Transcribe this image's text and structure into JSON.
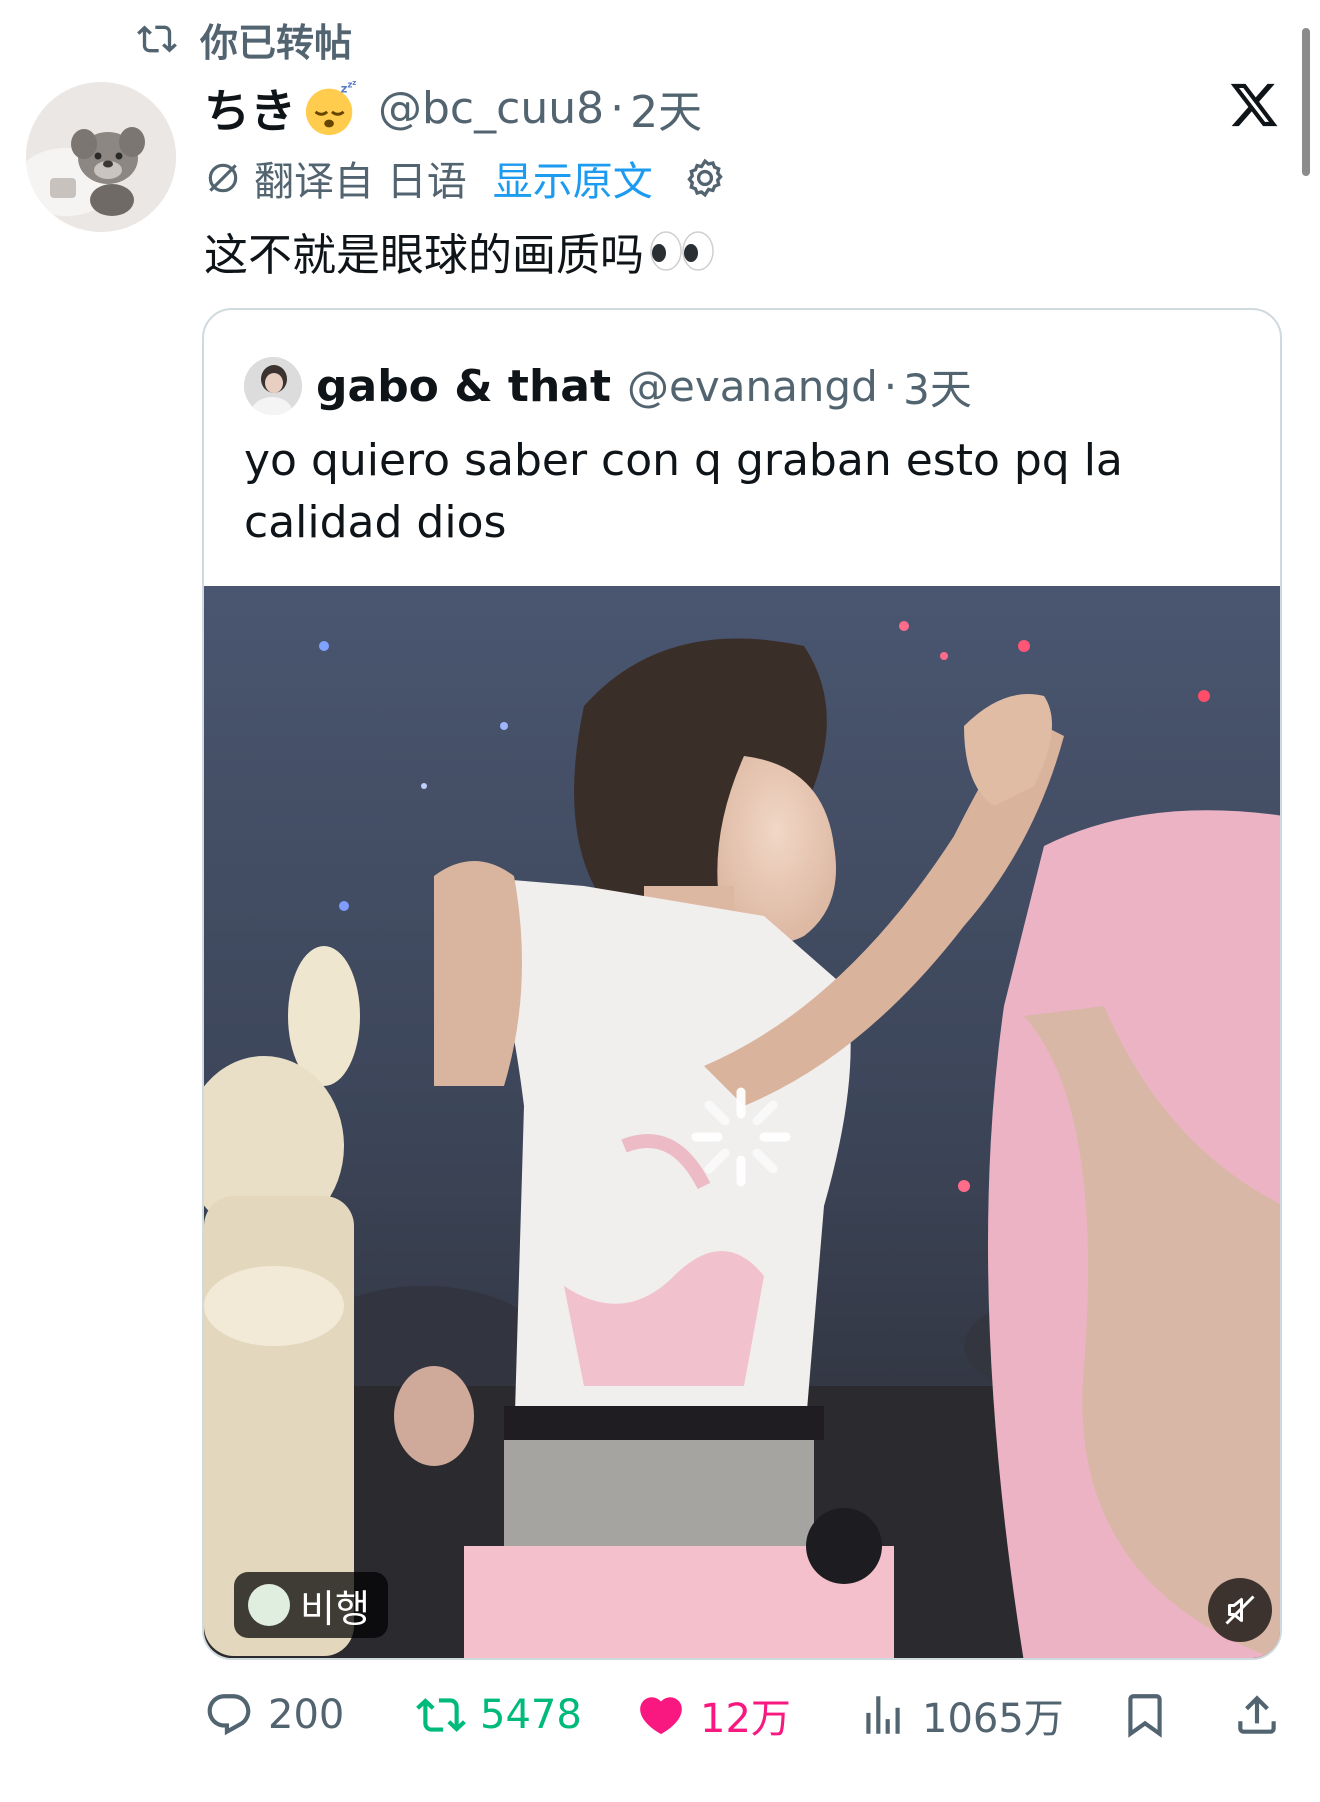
{
  "repost_banner": {
    "text": "你已转帖",
    "icon": "repost-icon"
  },
  "post": {
    "display_name": "ちき",
    "name_emoji": "sleeping-face-emoji",
    "handle": "@bc_cuu8",
    "separator": "·",
    "time": "2天",
    "translation": {
      "label": "翻译自 日语",
      "show_original": "显示原文",
      "settings_icon": "gear-icon"
    },
    "text": "这不就是眼球的画质吗",
    "text_emoji": "eyes-emoji"
  },
  "quote": {
    "display_name": "gabo & that",
    "handle": "@evanangd",
    "separator": "·",
    "time": "3天",
    "text_lines": [
      "yo quiero saber con q graban esto pq la",
      "calidad dios"
    ],
    "media": {
      "type": "video",
      "loading": true,
      "badge_text": "비행",
      "mute_icon": "muted-speaker-icon"
    }
  },
  "actions": {
    "replies": "200",
    "reposts": "5478",
    "likes": "12万",
    "views": "1065万"
  },
  "colors": {
    "text": "#0f1419",
    "secondary": "#536471",
    "link": "#1d9bf0",
    "repost_active": "#00ba7c",
    "like_active": "#f91880",
    "border": "#cfd9de"
  }
}
